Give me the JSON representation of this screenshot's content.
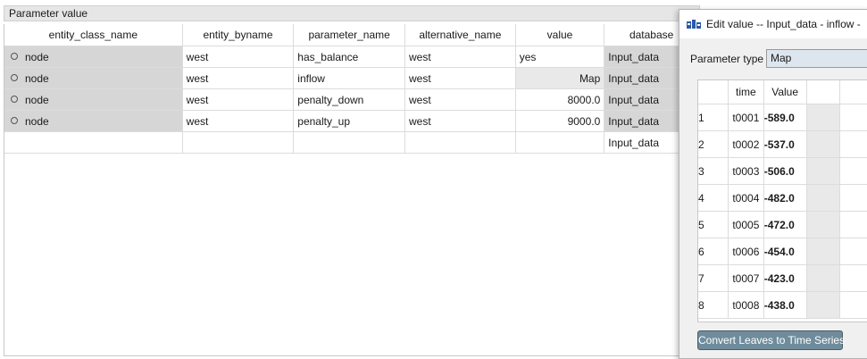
{
  "dock": {
    "title": "Parameter value"
  },
  "table": {
    "headers": [
      "entity_class_name",
      "entity_byname",
      "parameter_name",
      "alternative_name",
      "value",
      "database"
    ],
    "rows": [
      {
        "cls": "node",
        "byname": "west",
        "param": "has_balance",
        "alt": "west",
        "value": "yes",
        "db": "Input_data"
      },
      {
        "cls": "node",
        "byname": "west",
        "param": "inflow",
        "alt": "west",
        "value": "Map",
        "db": "Input_data"
      },
      {
        "cls": "node",
        "byname": "west",
        "param": "penalty_down",
        "alt": "west",
        "value": "8000.0",
        "db": "Input_data"
      },
      {
        "cls": "node",
        "byname": "west",
        "param": "penalty_up",
        "alt": "west",
        "value": "9000.0",
        "db": "Input_data"
      }
    ],
    "new_row": {
      "db": "Input_data"
    }
  },
  "dialog": {
    "title": "Edit value    -- Input_data - inflow -",
    "param_type_label": "Parameter type",
    "param_type_value": "Map",
    "map_headers": [
      "time",
      "Value"
    ],
    "map_rows": [
      {
        "idx": "1",
        "time": "t0001",
        "value": "-589.0"
      },
      {
        "idx": "2",
        "time": "t0002",
        "value": "-537.0"
      },
      {
        "idx": "3",
        "time": "t0003",
        "value": "-506.0"
      },
      {
        "idx": "4",
        "time": "t0004",
        "value": "-482.0"
      },
      {
        "idx": "5",
        "time": "t0005",
        "value": "-472.0"
      },
      {
        "idx": "6",
        "time": "t0006",
        "value": "-454.0"
      },
      {
        "idx": "7",
        "time": "t0007",
        "value": "-423.0"
      },
      {
        "idx": "8",
        "time": "t0008",
        "value": "-438.0"
      }
    ],
    "convert_button": "Convert Leaves to Time Series"
  }
}
